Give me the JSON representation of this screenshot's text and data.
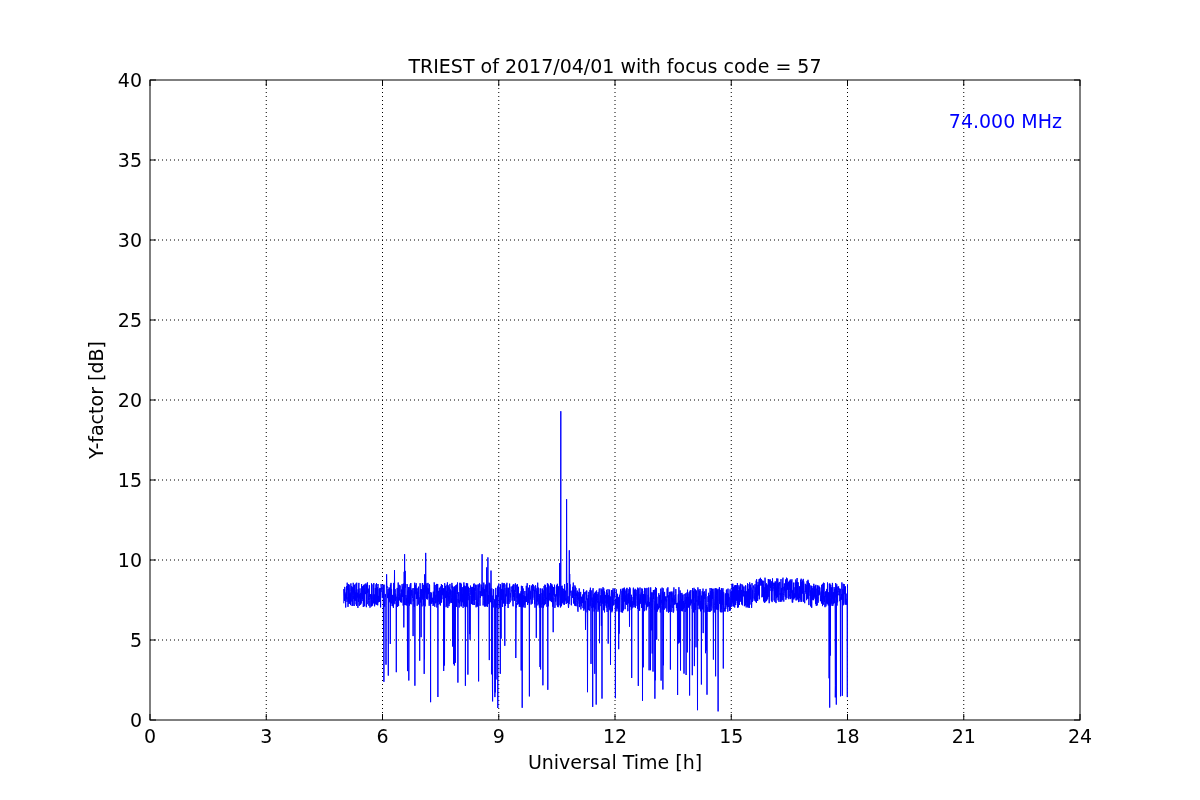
{
  "title": "TRIEST of 2017/04/01 with focus code = 57",
  "annotation": "74.000 MHz",
  "xlabel": "Universal Time [h]",
  "ylabel": "Y-factor [dB]",
  "xticks": [
    "0",
    "3",
    "6",
    "9",
    "12",
    "15",
    "18",
    "21",
    "24"
  ],
  "yticks": [
    "40",
    "35",
    "30",
    "25",
    "20",
    "15",
    "10",
    "5",
    "0"
  ]
}
